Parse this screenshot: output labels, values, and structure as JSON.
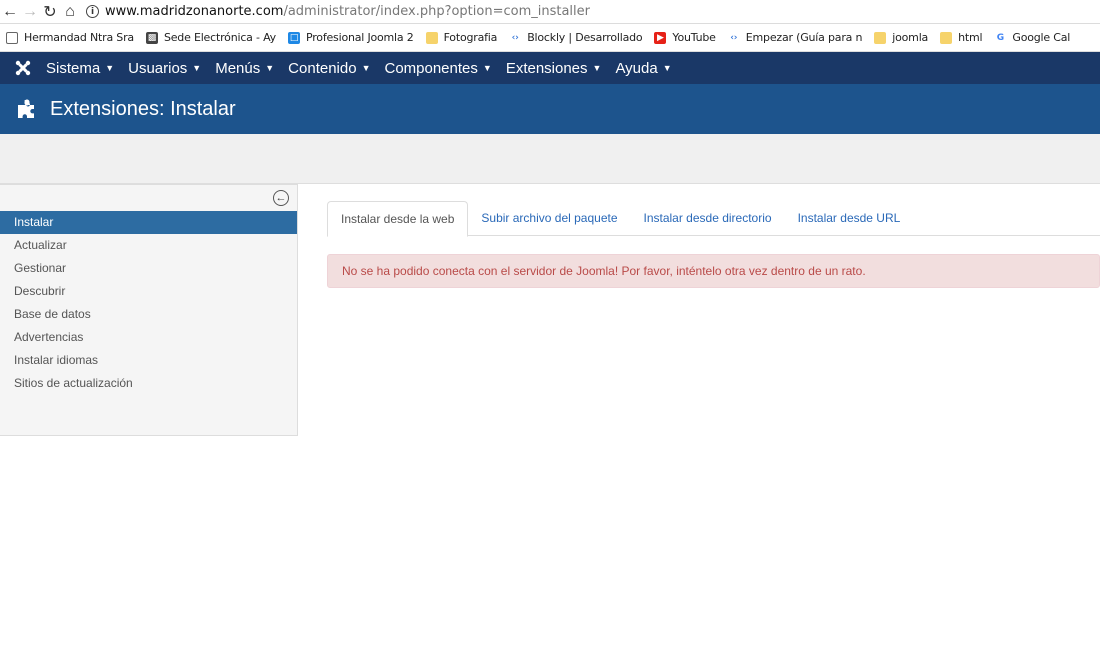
{
  "browser": {
    "url_host": "www.madridzonanorte.com",
    "url_path": "/administrator/index.php?option=com_installer",
    "bookmarks": [
      {
        "label": "Hermandad Ntra Sra",
        "icon": "page-icon"
      },
      {
        "label": "Sede Electrónica - Ay",
        "icon": "sede-icon"
      },
      {
        "label": "Profesional Joomla 2",
        "icon": "app-icon"
      },
      {
        "label": "Fotografia",
        "icon": "folder-icon"
      },
      {
        "label": "Blockly | Desarrollado",
        "icon": "code-icon"
      },
      {
        "label": "YouTube",
        "icon": "youtube-icon"
      },
      {
        "label": "Empezar (Guía para n",
        "icon": "code-icon"
      },
      {
        "label": "joomla",
        "icon": "folder-icon"
      },
      {
        "label": "html",
        "icon": "folder-icon"
      },
      {
        "label": "Google Cal",
        "icon": "google-icon"
      }
    ]
  },
  "topnav": {
    "items": [
      "Sistema",
      "Usuarios",
      "Menús",
      "Contenido",
      "Componentes",
      "Extensiones",
      "Ayuda"
    ]
  },
  "header": {
    "title": "Extensiones: Instalar"
  },
  "sidebar": {
    "items": [
      "Instalar",
      "Actualizar",
      "Gestionar",
      "Descubrir",
      "Base de datos",
      "Advertencias",
      "Instalar idiomas",
      "Sitios de actualización"
    ]
  },
  "tabs": [
    "Instalar desde la web",
    "Subir archivo del paquete",
    "Instalar desde directorio",
    "Instalar desde URL"
  ],
  "alert": {
    "message": "No se ha podido conecta con el servidor de Joomla! Por favor, inténtelo otra vez dentro de un rato."
  },
  "colors": {
    "topnav_bg": "#1a3867",
    "header_bg": "#1d548d",
    "active_item": "#2d6ca2",
    "alert_bg": "#f2dede",
    "alert_text": "#b94a48",
    "link": "#2a69b8"
  }
}
